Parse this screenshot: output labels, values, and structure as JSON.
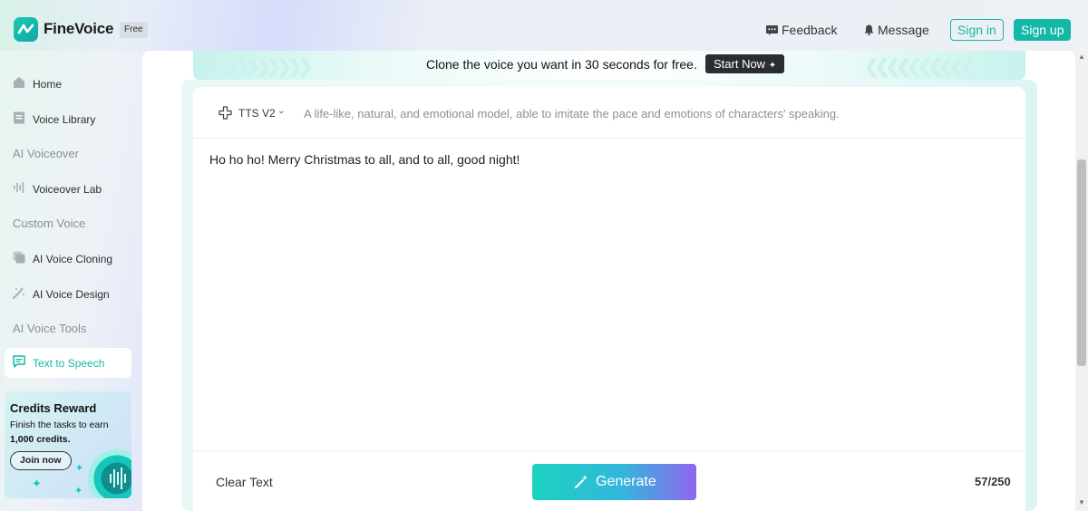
{
  "app": {
    "name": "FineVoice",
    "badge": "Free"
  },
  "header": {
    "feedback": "Feedback",
    "message": "Message",
    "sign_in": "Sign in",
    "sign_up": "Sign up"
  },
  "sidebar": {
    "home": "Home",
    "voice_library": "Voice Library",
    "section_ai_voiceover": "AI Voiceover",
    "voiceover_lab": "Voiceover Lab",
    "section_custom_voice": "Custom Voice",
    "ai_voice_cloning": "AI Voice Cloning",
    "ai_voice_design": "AI Voice Design",
    "section_ai_voice_tools": "AI Voice Tools",
    "text_to_speech": "Text to Speech"
  },
  "credits": {
    "title": "Credits Reward",
    "desc_prefix": "Finish the tasks to earn",
    "desc_amount": "1,000 credits.",
    "join": "Join now"
  },
  "banner": {
    "text": "Clone the voice you want in 30 seconds for free.",
    "cta": "Start Now"
  },
  "editor": {
    "model": "TTS V2",
    "model_desc": "A life-like, natural, and emotional model, able to imitate the pace and emotions of characters' speaking.",
    "text": "Ho ho ho! Merry Christmas to all, and to all, good night!",
    "clear": "Clear Text",
    "generate": "Generate",
    "count": "57/250"
  },
  "colors": {
    "accent": "#14b8a6",
    "generate_start": "#1ad3bf",
    "generate_end": "#9165f0",
    "active_text": "#14b8a6"
  }
}
